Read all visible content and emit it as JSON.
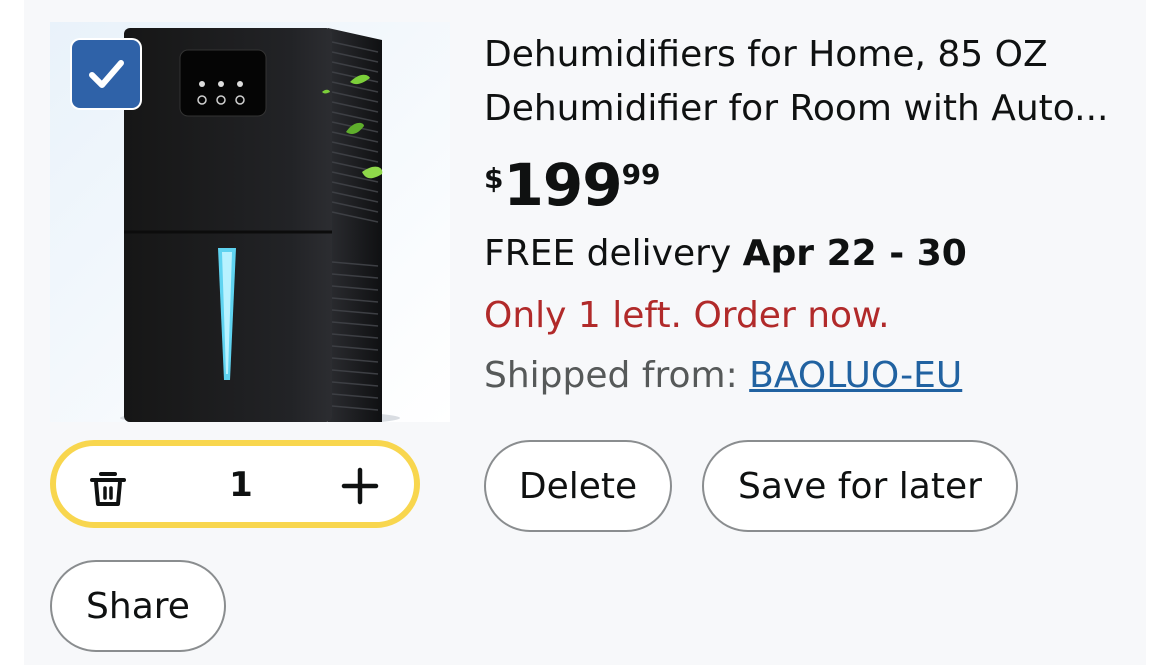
{
  "item": {
    "title": "Dehumidifiers for Home, 85 OZ Dehumidifier for Room with Auto...",
    "price": {
      "currency": "$",
      "whole": "199",
      "fraction": "99"
    },
    "delivery": {
      "prefix": "FREE delivery ",
      "dates": "Apr 22 - 30"
    },
    "stock": "Only 1 left. Order now.",
    "shipped_label": "Shipped from: ",
    "seller": "BAOLUO-EU",
    "selected": true
  },
  "quantity": {
    "value": "1"
  },
  "actions": {
    "delete_label": "Delete",
    "save_label": "Save for later",
    "share_label": "Share"
  },
  "colors": {
    "checkbox": "#2f62a8",
    "quantity_border": "#f8d64e",
    "stock_red": "#b12a2a",
    "link_blue": "#2162a1"
  },
  "icons": [
    "checkmark-icon",
    "trash-icon",
    "plus-icon"
  ]
}
